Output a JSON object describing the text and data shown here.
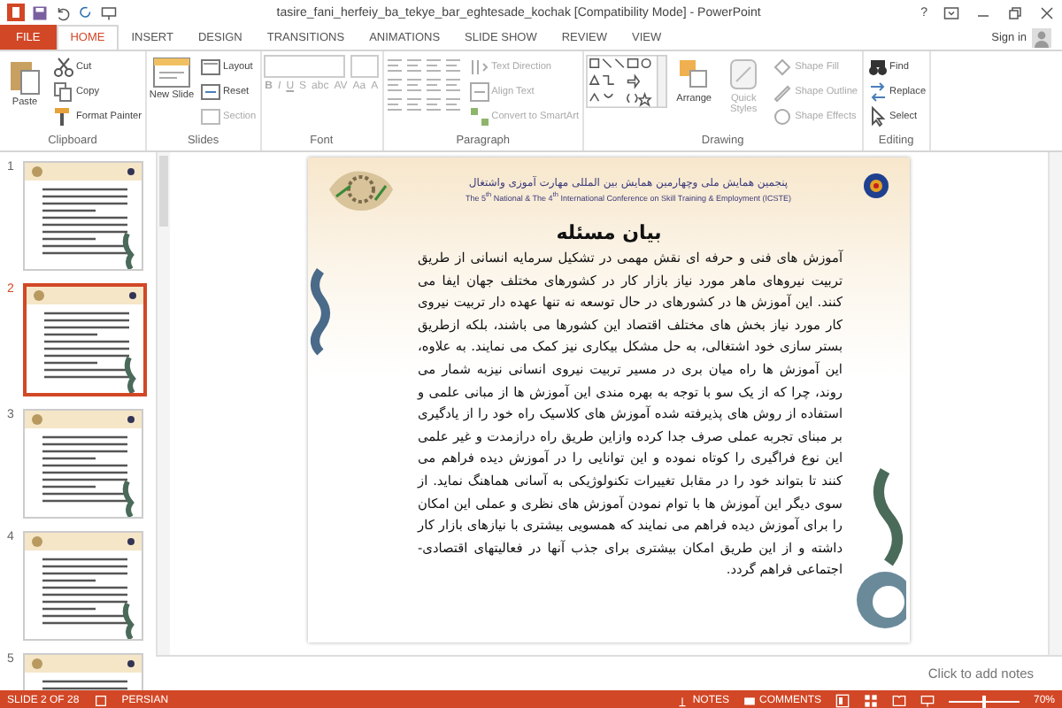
{
  "window": {
    "title": "tasire_fani_herfeiy_ba_tekye_bar_eghtesade_kochak [Compatibility Mode] - PowerPoint",
    "help": "?",
    "sign_in": "Sign in"
  },
  "tabs": [
    {
      "label": "FILE",
      "kind": "file",
      "selected": false
    },
    {
      "label": "HOME",
      "kind": "tab",
      "selected": true
    },
    {
      "label": "INSERT",
      "kind": "tab",
      "selected": false
    },
    {
      "label": "DESIGN",
      "kind": "tab",
      "selected": false
    },
    {
      "label": "TRANSITIONS",
      "kind": "tab",
      "selected": false
    },
    {
      "label": "ANIMATIONS",
      "kind": "tab",
      "selected": false
    },
    {
      "label": "SLIDE SHOW",
      "kind": "tab",
      "selected": false
    },
    {
      "label": "REVIEW",
      "kind": "tab",
      "selected": false
    },
    {
      "label": "VIEW",
      "kind": "tab",
      "selected": false
    }
  ],
  "ribbon": [
    {
      "label": "Clipboard",
      "items": [
        {
          "kind": "large",
          "label": "Paste",
          "disabled": false
        },
        {
          "kind": "small",
          "label": "Cut",
          "disabled": false
        },
        {
          "kind": "small",
          "label": "Copy",
          "disabled": false
        },
        {
          "kind": "small",
          "label": "Format Painter",
          "disabled": false
        }
      ]
    },
    {
      "label": "Slides",
      "items": [
        {
          "kind": "large",
          "label": "New Slide",
          "disabled": false
        },
        {
          "kind": "small",
          "label": "Layout",
          "disabled": false
        },
        {
          "kind": "small",
          "label": "Reset",
          "disabled": false
        },
        {
          "kind": "small",
          "label": "Section",
          "disabled": true
        }
      ]
    },
    {
      "label": "Font",
      "items": [
        {
          "kind": "glyphs",
          "labels": [
            "B",
            "I",
            "U",
            "S",
            "abc",
            "AV",
            "Aa",
            "A"
          ],
          "disabled": true
        }
      ]
    },
    {
      "label": "Paragraph",
      "items": [
        {
          "kind": "icons"
        },
        {
          "kind": "small",
          "label": "Text Direction",
          "disabled": true
        },
        {
          "kind": "small",
          "label": "Align Text",
          "disabled": true
        },
        {
          "kind": "small",
          "label": "Convert to SmartArt",
          "disabled": true
        }
      ]
    },
    {
      "label": "Drawing",
      "items": [
        {
          "kind": "gallery"
        },
        {
          "kind": "large",
          "label": "Arrange",
          "disabled": false
        },
        {
          "kind": "large",
          "label": "Quick Styles",
          "disabled": true
        },
        {
          "kind": "small",
          "label": "Shape Fill",
          "disabled": true
        },
        {
          "kind": "small",
          "label": "Shape Outline",
          "disabled": true
        },
        {
          "kind": "small",
          "label": "Shape Effects",
          "disabled": true
        }
      ]
    },
    {
      "label": "Editing",
      "items": [
        {
          "kind": "small",
          "label": "Find",
          "disabled": false
        },
        {
          "kind": "small",
          "label": "Replace",
          "disabled": false
        },
        {
          "kind": "small",
          "label": "Select",
          "disabled": false
        }
      ]
    }
  ],
  "thumbnails": [
    {
      "number": "1",
      "selected": false
    },
    {
      "number": "2",
      "selected": true
    },
    {
      "number": "3",
      "selected": false
    },
    {
      "number": "4",
      "selected": false
    },
    {
      "number": "5",
      "selected": false
    }
  ],
  "slide": {
    "header_fa": "پنجمین همایش ملی وچهارمین همایش بین المللی مهارت آموزی واشتغال",
    "header_en": "The 5$^{th}$ National & The 4$^{th}$ International Conference on Skill Training & Employment (ICSTE)",
    "title": "بیان مسئله",
    "body": "آموزش های فنی و حرفه ای نقش مهمی در تشکیل سرمایه انسانی از طریق تربیت نیروهای ماهر مورد نیاز بازار کار در کشورهای مختلف جهان ایفا می کنند. این آموزش ها در کشورهای در حال توسعه نه تنها عهده دار تربیت نیروی کار مورد نیاز بخش های مختلف اقتصاد این کشورها می باشند، بلکه ازطریق بستر سازی خود اشتغالی، به حل مشکل بیکاری نیز کمک می نمایند. به علاوه، این آموزش ها راه میان بری در مسیر تربیت نیروی انسانی نیزبه شمار می روند، چرا که از یک سو با توجه به بهره مندی این آموزش ها از مبانی علمی و استفاده از روش های پذیرفته شده آموزش های کلاسیک راه خود را از یادگیری بر مبنای تجربه عملی صرف جدا کرده وازاین طریق راه درازمدت و غیر علمی این نوع فراگیری را کوتاه نموده و این توانایی را در آموزش دیده فراهم می کنند تا بتواند خود را در مقابل تغییرات تکنولوژیکی به آسانی هماهنگ نماید. از سوی دیگر این آموزش ها با توام نمودن آموزش های نظری و عملی این امکان را برای آموزش دیده فراهم می نمایند که همسویی بیشتری با نیازهای بازار کار داشته و از این طریق امکان بیشتری برای جذب آنها در فعالیتهای اقتصادی- اجتماعی فراهم گردد."
  },
  "notes": {
    "placeholder": "Click to add notes"
  },
  "status_bar": {
    "slide": "SLIDE 2 OF 28",
    "language": "PERSIAN",
    "notes": "NOTES",
    "comments": "COMMENTS",
    "zoom": "70%",
    "zoom_slider": {
      "level": 0.5
    }
  }
}
